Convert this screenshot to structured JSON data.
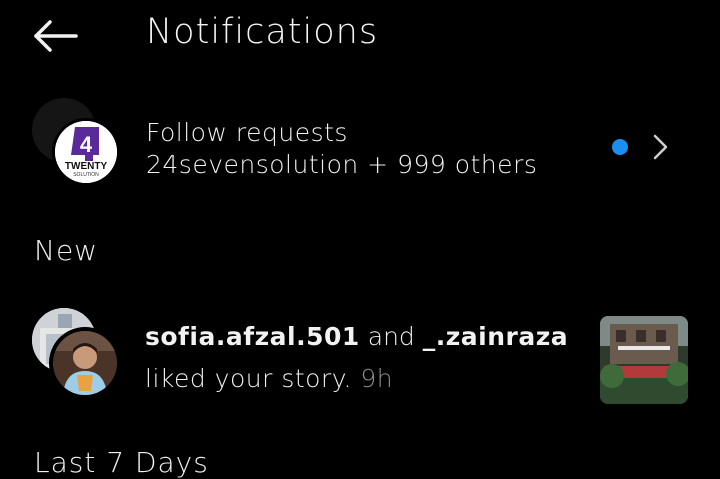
{
  "header": {
    "back_icon": "arrow-left-icon",
    "title": "Notifications"
  },
  "follow_requests": {
    "title": "Follow requests",
    "subtitle": "24sevensolution + 999 others",
    "avatar_logo_number": "4",
    "avatar_logo_text": "TWENTY",
    "avatar_logo_subtext": "SOLUTION",
    "unread_dot_color": "#1a8ff0",
    "chevron_icon": "chevron-right-icon"
  },
  "sections": {
    "new_label": "New",
    "last_label": "Last 7 Days"
  },
  "activity": {
    "user1": "sofia.afzal.501",
    "conjunction": "and",
    "user2": "_.zainraza",
    "action": "liked your story.",
    "time": "9h"
  }
}
